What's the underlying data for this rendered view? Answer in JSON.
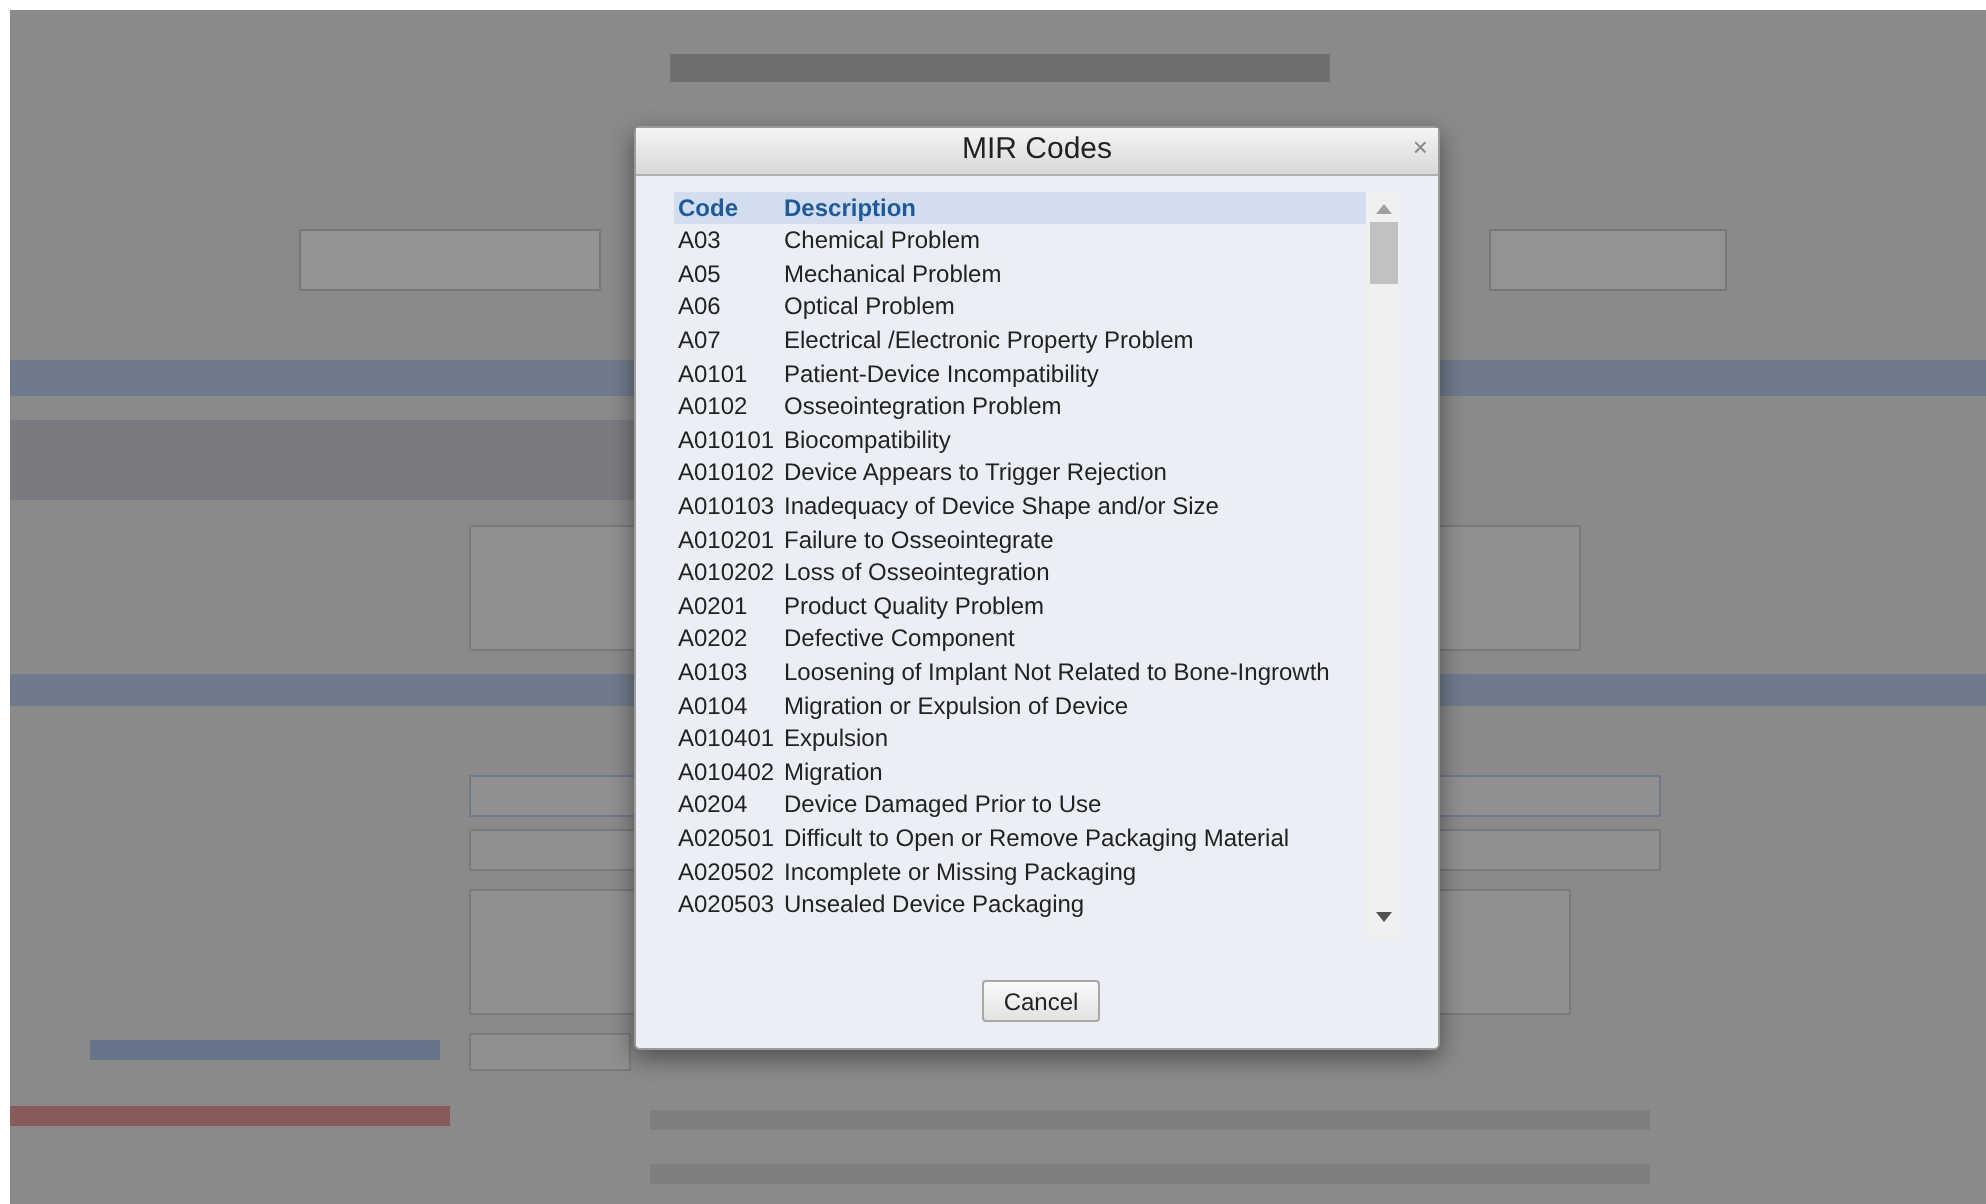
{
  "dialog": {
    "title": "MIR Codes",
    "close": "×",
    "columns": [
      "Code",
      "Description"
    ],
    "rows": [
      {
        "code": "A03",
        "description": "Chemical Problem"
      },
      {
        "code": "A05",
        "description": "Mechanical Problem"
      },
      {
        "code": "A06",
        "description": "Optical Problem"
      },
      {
        "code": "A07",
        "description": "Electrical /Electronic Property Problem"
      },
      {
        "code": "A0101",
        "description": "Patient-Device Incompatibility"
      },
      {
        "code": "A0102",
        "description": "Osseointegration Problem"
      },
      {
        "code": "A010101",
        "description": "Biocompatibility"
      },
      {
        "code": "A010102",
        "description": "Device Appears to Trigger Rejection"
      },
      {
        "code": "A010103",
        "description": "Inadequacy of Device Shape and/or Size"
      },
      {
        "code": "A010201",
        "description": "Failure to Osseointegrate"
      },
      {
        "code": "A010202",
        "description": "Loss of Osseointegration"
      },
      {
        "code": "A0201",
        "description": "Product Quality Problem"
      },
      {
        "code": "A0202",
        "description": "Defective Component"
      },
      {
        "code": "A0103",
        "description": "Loosening of Implant Not Related to Bone-Ingrowth"
      },
      {
        "code": "A0104",
        "description": "Migration or Expulsion of Device"
      },
      {
        "code": "A010401",
        "description": "Expulsion"
      },
      {
        "code": "A010402",
        "description": "Migration"
      },
      {
        "code": "A0204",
        "description": "Device Damaged Prior to Use"
      },
      {
        "code": "A020501",
        "description": "Difficult to Open or Remove Packaging Material"
      },
      {
        "code": "A020502",
        "description": "Incomplete or Missing Packaging"
      },
      {
        "code": "A020503",
        "description": "Unsealed Device Packaging"
      }
    ],
    "buttons": [
      "Cancel"
    ]
  }
}
